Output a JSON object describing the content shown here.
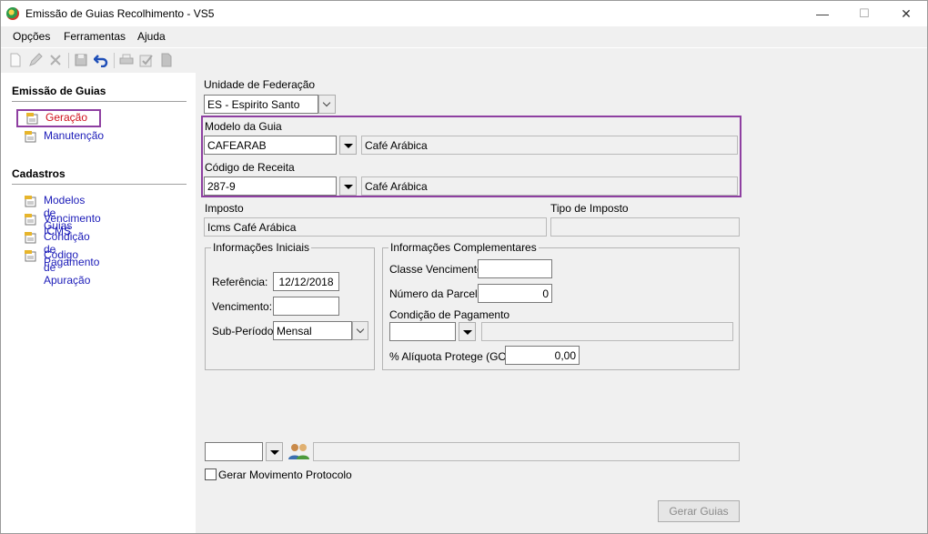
{
  "window": {
    "title": "Emissão de Guias Recolhimento - VS5",
    "minimize": "—",
    "maximize": "☐",
    "close": "✕"
  },
  "menu": [
    {
      "label": "Opções"
    },
    {
      "label": "Ferramentas"
    },
    {
      "label": "Ajuda"
    }
  ],
  "toolbar": [
    "new-icon",
    "edit-icon",
    "delete-icon",
    "save-icon",
    "undo-icon",
    "print-icon",
    "check-icon",
    "document-icon"
  ],
  "sidebar": {
    "section1": "Emissão de Guias",
    "items1": [
      {
        "label": "Geração"
      },
      {
        "label": "Manutenção"
      }
    ],
    "section2": "Cadastros",
    "items2": [
      {
        "label": "Modelos de Guias"
      },
      {
        "label": "Vencimento ICMS"
      },
      {
        "label": "Condição de Pagamento"
      },
      {
        "label": "Código de Apuração"
      }
    ]
  },
  "form": {
    "uf_label": "Unidade de Federação",
    "uf_value": "ES - Espirito Santo",
    "modelo_label": "Modelo da Guia",
    "modelo_value": "CAFEARAB",
    "modelo_desc": "Café Arábica",
    "codigo_label": "Código de Receita",
    "codigo_value": "287-9",
    "codigo_desc": "Café Arábica",
    "imposto_label": "Imposto",
    "imposto_value": "Icms Café Arábica",
    "tipo_label": "Tipo de Imposto",
    "tipo_value": ""
  },
  "iniciais": {
    "title": "Informações Iniciais",
    "referencia_label": "Referência:",
    "referencia_value": "12/12/2018",
    "vencimento_label": "Vencimento:",
    "vencimento_value": "",
    "subperiodo_label": "Sub-Período:",
    "subperiodo_value": "Mensal"
  },
  "complementares": {
    "title": "Informações Complementares",
    "classe_label": "Classe Vencimento:",
    "classe_value": "",
    "parcela_label": "Número da Parcela:",
    "parcela_value": "0",
    "condicao_label": "Condição de Pagamento",
    "condicao_value": "",
    "condicao_desc": "",
    "aliquota_label": "% Alíquota Protege (GO):",
    "aliquota_value": "0,00"
  },
  "bottom": {
    "protocolo_value": "",
    "protocolo_desc": "",
    "checkbox_label": "Gerar Movimento Protocolo",
    "gerar_button": "Gerar Guias"
  }
}
